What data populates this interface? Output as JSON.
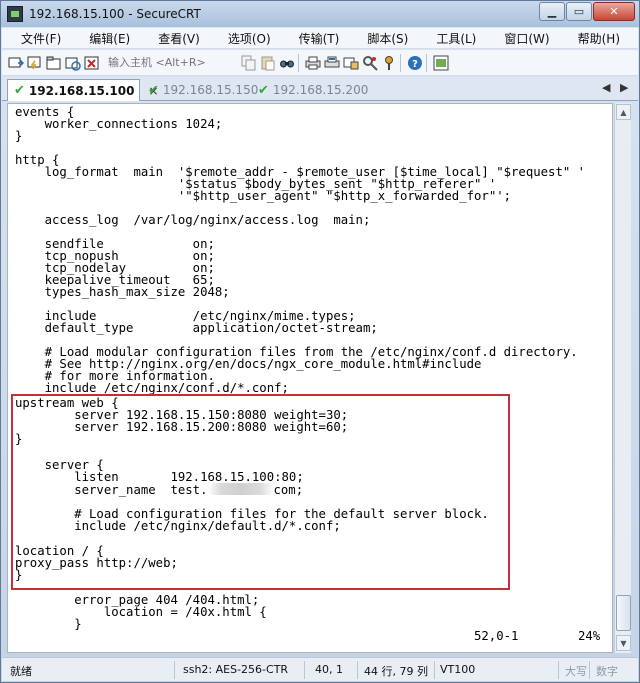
{
  "window": {
    "title": "192.168.15.100 - SecureCRT",
    "minimize_label": "▁",
    "maximize_label": "▭",
    "close_label": "✕"
  },
  "menu": {
    "items": [
      "文件(F)",
      "编辑(E)",
      "查看(V)",
      "选项(O)",
      "传输(T)",
      "脚本(S)",
      "工具(L)",
      "窗口(W)",
      "帮助(H)"
    ]
  },
  "toolbar": {
    "host_placeholder": "输入主机 <Alt+R>",
    "icons": [
      "connect-icon",
      "quick-connect-icon",
      "connect-tab-icon",
      "reconnect-icon",
      "disconnect-icon",
      "copy-icon",
      "paste-icon",
      "find-icon",
      "print-icon",
      "print-selection-icon",
      "sftp-icon",
      "session-options-icon",
      "keymap-icon",
      "help-icon",
      "script-icon"
    ]
  },
  "tabs": {
    "items": [
      {
        "label": "192.168.15.100",
        "active": true
      },
      {
        "label": "192.168.15.150",
        "active": false
      },
      {
        "label": "192.168.15.200",
        "active": false
      }
    ],
    "close_label": "×",
    "prev_label": "◀",
    "next_label": "▶"
  },
  "terminal": {
    "lines": [
      "events {",
      "    worker_connections 1024;",
      "}",
      "",
      "http {",
      "    log_format  main  '$remote_addr - $remote_user [$time_local] \"$request\" '",
      "                      '$status $body_bytes_sent \"$http_referer\" '",
      "                      '\"$http_user_agent\" \"$http_x_forwarded_for\"';",
      "",
      "    access_log  /var/log/nginx/access.log  main;",
      "",
      "    sendfile            on;",
      "    tcp_nopush          on;",
      "    tcp_nodelay         on;",
      "    keepalive_timeout   65;",
      "    types_hash_max_size 2048;",
      "",
      "    include             /etc/nginx/mime.types;",
      "    default_type        application/octet-stream;",
      "",
      "    # Load modular configuration files from the /etc/nginx/conf.d directory.",
      "    # See http://nginx.org/en/docs/ngx_core_module.html#include",
      "    # for more information.",
      "    include /etc/nginx/conf.d/*.conf;",
      "upstream web {",
      "        server 192.168.15.150:8080 weight=30;",
      "        server 192.168.15.200:8080 weight=60;",
      "}",
      "",
      "    server {",
      "        listen       192.168.15.100:80;",
      "        server_name  test.",
      "",
      "        # Load configuration files for the default server block.",
      "        include /etc/nginx/default.d/*.conf;",
      "",
      "location / {",
      "proxy_pass http://web;",
      "}",
      "",
      "        error_page 404 /404.html;",
      "            location = /40x.html {",
      "        }"
    ],
    "server_name_suffix": "com;",
    "cursor_position": "52,0-1",
    "scroll_percent": "24%"
  },
  "statusbar": {
    "ready": "就绪",
    "cipher": "ssh2: AES-256-CTR",
    "cursor": "40,  1",
    "size": "44 行, 79 列",
    "terminal_type": "VT100",
    "caps": "大写",
    "num": "数字"
  },
  "colors": {
    "highlight_box": "#c4303a",
    "check_green": "#3aa63a"
  }
}
